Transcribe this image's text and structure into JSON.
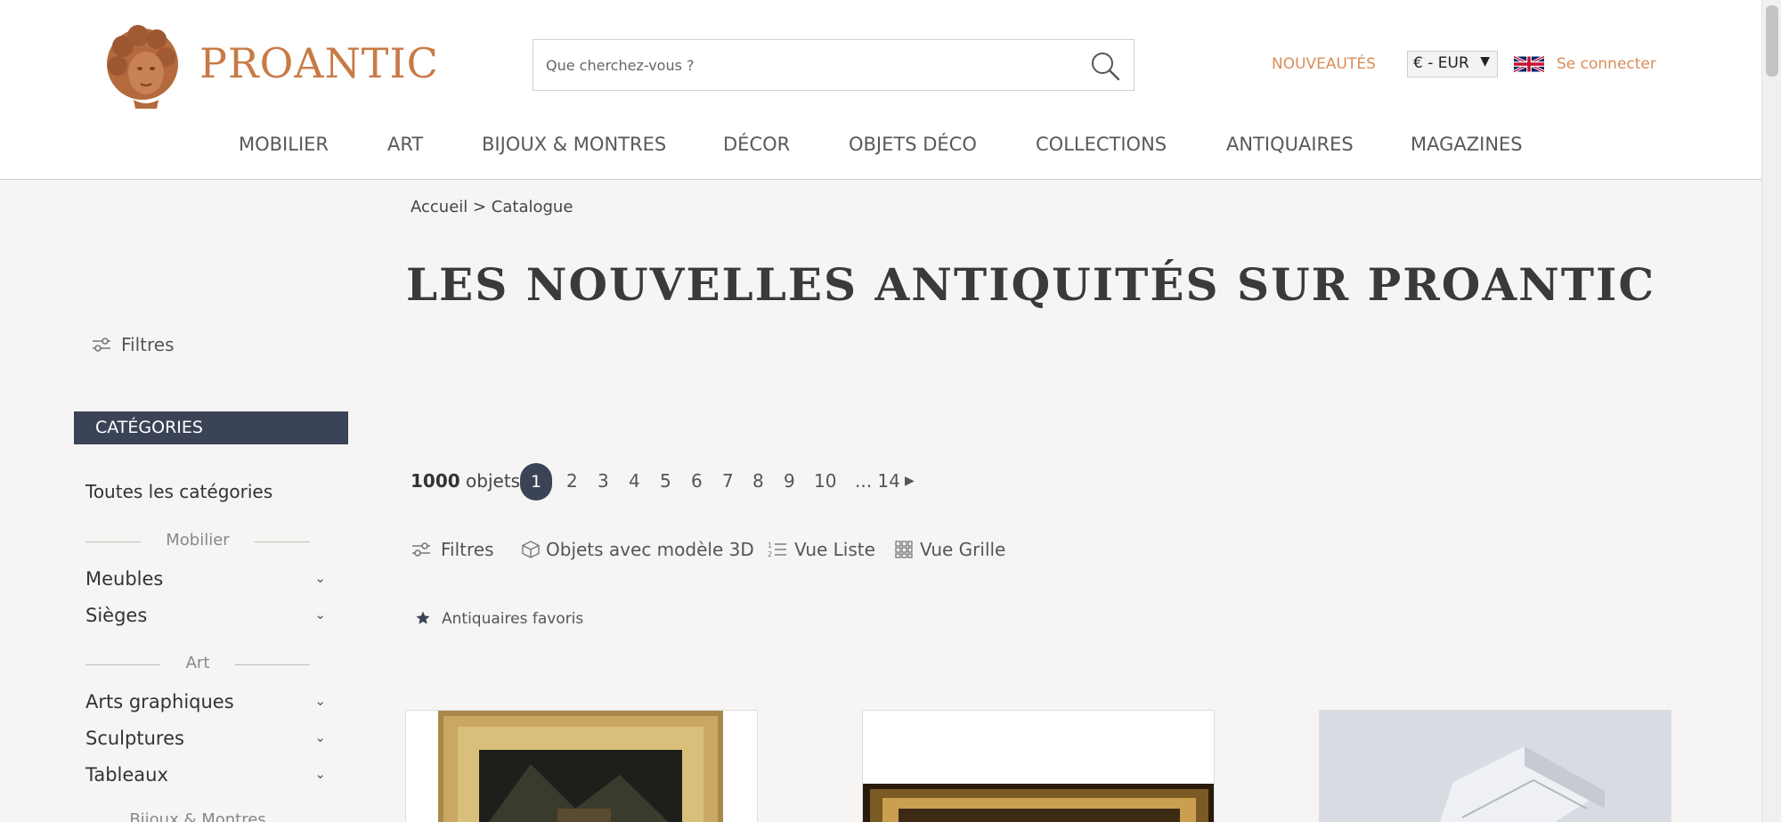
{
  "header": {
    "logo_text": "PROANTIC",
    "search_placeholder": "Que cherchez-vous ?",
    "nouveautes": "NOUVEAUTÉS",
    "currency": "€ - EUR",
    "login": "Se connecter"
  },
  "nav": {
    "items": [
      "MOBILIER",
      "ART",
      "BIJOUX & MONTRES",
      "DÉCOR",
      "OBJETS DÉCO",
      "COLLECTIONS",
      "ANTIQUAIRES",
      "MAGAZINES"
    ]
  },
  "breadcrumb": "Accueil > Catalogue",
  "page_title": "LES NOUVELLES ANTIQUITÉS SUR PROANTIC",
  "sidebar": {
    "filters_label": "Filtres",
    "categories_title": "CATÉGORIES",
    "all_categories": "Toutes les catégories",
    "groups": [
      {
        "name": "Mobilier",
        "items": [
          "Meubles",
          "Sièges"
        ]
      },
      {
        "name": "Art",
        "items": [
          "Arts graphiques",
          "Sculptures",
          "Tableaux"
        ]
      },
      {
        "name": "Bijoux & Montres",
        "items": []
      }
    ]
  },
  "results": {
    "count_bold": "1000",
    "count_label": "objets",
    "pages": [
      "1",
      "2",
      "3",
      "4",
      "5",
      "6",
      "7",
      "8",
      "9",
      "10",
      "... 14"
    ],
    "current_page": "1"
  },
  "toolbar": {
    "filters": "Filtres",
    "model3d": "Objets avec modèle 3D",
    "list_view": "Vue Liste",
    "grid_view": "Vue Grille",
    "favorites": "Antiquaires favoris"
  },
  "colors": {
    "accent": "#c87a47",
    "nav_text": "#55595c",
    "dark": "#3b4456",
    "background": "#f6f5f3"
  }
}
